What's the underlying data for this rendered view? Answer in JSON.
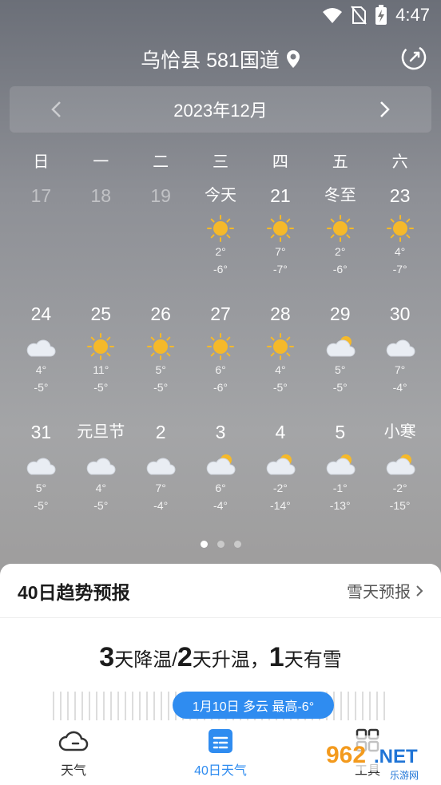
{
  "status": {
    "time": "4:47",
    "icons": [
      "wifi-icon",
      "no-sim-icon",
      "battery-charging-icon"
    ]
  },
  "header": {
    "location": "乌恰县 581国道",
    "location_icon": "location-pin-icon",
    "refresh_icon": "refresh-icon"
  },
  "month_nav": {
    "label": "2023年12月",
    "prev_icon": "chevron-left-icon",
    "next_icon": "chevron-right-icon"
  },
  "weekdays": [
    "日",
    "一",
    "二",
    "三",
    "四",
    "五",
    "六"
  ],
  "weeks": [
    [
      {
        "day": "17",
        "past": true
      },
      {
        "day": "18",
        "past": true
      },
      {
        "day": "19",
        "past": true
      },
      {
        "day": "今天",
        "icon": "sunny",
        "high": "2°",
        "low": "-6°"
      },
      {
        "day": "21",
        "icon": "sunny",
        "high": "7°",
        "low": "-7°"
      },
      {
        "day": "冬至",
        "icon": "sunny",
        "high": "2°",
        "low": "-6°"
      },
      {
        "day": "23",
        "icon": "sunny",
        "high": "4°",
        "low": "-7°"
      }
    ],
    [
      {
        "day": "24",
        "icon": "cloudy",
        "high": "4°",
        "low": "-5°"
      },
      {
        "day": "25",
        "icon": "sunny",
        "high": "11°",
        "low": "-5°"
      },
      {
        "day": "26",
        "icon": "sunny",
        "high": "5°",
        "low": "-5°"
      },
      {
        "day": "27",
        "icon": "sunny",
        "high": "6°",
        "low": "-6°"
      },
      {
        "day": "28",
        "icon": "sunny",
        "high": "4°",
        "low": "-5°"
      },
      {
        "day": "29",
        "icon": "partly-cloudy",
        "high": "5°",
        "low": "-5°"
      },
      {
        "day": "30",
        "icon": "cloudy",
        "high": "7°",
        "low": "-4°"
      }
    ],
    [
      {
        "day": "31",
        "icon": "cloudy",
        "high": "5°",
        "low": "-5°"
      },
      {
        "day": "元旦节",
        "icon": "cloudy",
        "high": "4°",
        "low": "-5°"
      },
      {
        "day": "2",
        "icon": "cloudy",
        "high": "7°",
        "low": "-4°"
      },
      {
        "day": "3",
        "icon": "partly-cloudy",
        "high": "6°",
        "low": "-4°"
      },
      {
        "day": "4",
        "icon": "partly-cloudy",
        "high": "-2°",
        "low": "-14°"
      },
      {
        "day": "5",
        "icon": "partly-cloudy",
        "high": "-1°",
        "low": "-13°"
      },
      {
        "day": "小寒",
        "icon": "partly-cloudy",
        "high": "-2°",
        "low": "-15°"
      }
    ]
  ],
  "pager": {
    "count": 3,
    "active": 0
  },
  "trend": {
    "title": "40日趋势预报",
    "snow_link": "雪天预报",
    "summary": {
      "n1": "3",
      "t1": "天降温/",
      "n2": "2",
      "t2": "天升温，",
      "n3": "1",
      "t3": "天有雪"
    },
    "pill": "1月10日 多云 最高-6°"
  },
  "tabs": [
    {
      "label": "天气",
      "icon": "cloud-icon",
      "active": false
    },
    {
      "label": "40日天气",
      "icon": "calendar-list-icon",
      "active": true
    },
    {
      "label": "工具",
      "icon": "apps-grid-icon",
      "active": false
    }
  ],
  "watermark": {
    "text1": "962",
    "text2": ".NET",
    "text3": "乐游网"
  },
  "colors": {
    "accent": "#2f8cf0",
    "sun": "#f5b92a",
    "cloud": "#e9edf3"
  }
}
